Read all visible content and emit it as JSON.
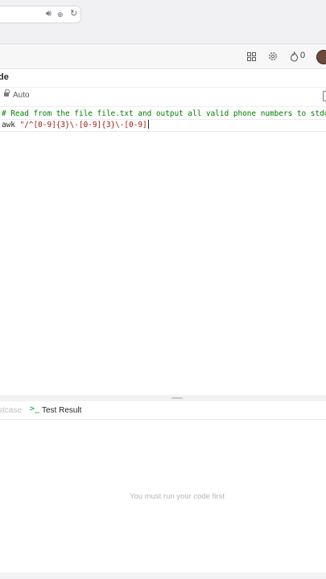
{
  "editor": {
    "title": "de",
    "language": "Auto",
    "code_lines": [
      "# Read from the file file.txt and output all valid phone numbers to stdout.",
      "awk ",
      "\"/^[0-9]{3}\\-[0-9]{3}\\-[0-9]"
    ]
  },
  "header": {
    "streak_count": "0"
  },
  "console": {
    "tab_testcase": "stcase",
    "tab_test_result": "Test Result",
    "empty_message": "You must run your code first"
  },
  "icons": {
    "speaker": "speaker-icon",
    "translate": "translate-icon",
    "reload": "reload-icon",
    "layout": "layout-grid-icon",
    "settings": "gear-icon",
    "streak": "flame-icon",
    "lock": "lock-icon",
    "terminal": "terminal-prompt-icon"
  },
  "colors": {
    "comment": "#008000",
    "string": "#a31515",
    "terminal_icon": "#2db55d"
  }
}
